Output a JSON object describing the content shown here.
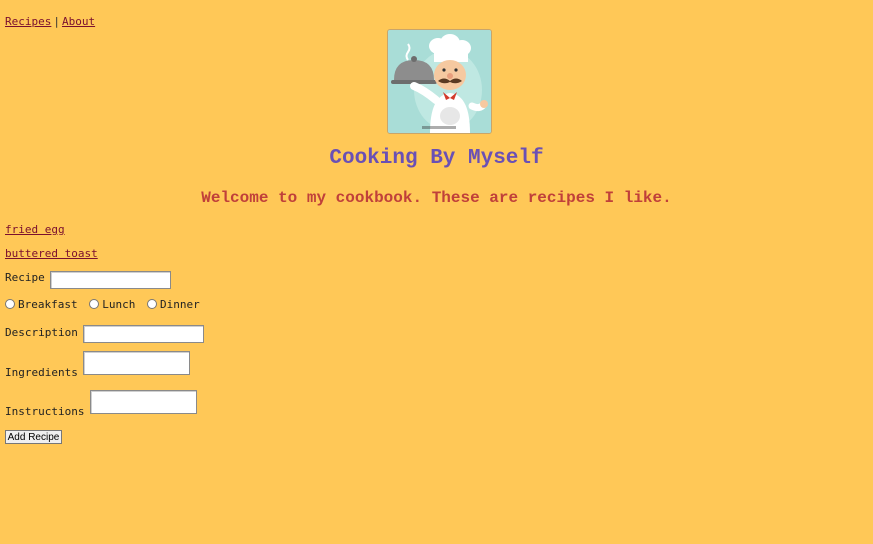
{
  "nav": {
    "recipes": "Recipes",
    "separator": "|",
    "about": "About"
  },
  "header": {
    "title": "Cooking By Myself",
    "subtitle": "Welcome to my cookbook. These are recipes I like."
  },
  "recipes": [
    "fried egg",
    "buttered toast"
  ],
  "form": {
    "recipe_label": "Recipe",
    "recipe_value": "",
    "meal_options": [
      "Breakfast",
      "Lunch",
      "Dinner"
    ],
    "description_label": "Description",
    "description_value": "",
    "ingredients_label": "Ingredients",
    "ingredients_value": "",
    "instructions_label": "Instructions",
    "instructions_value": "",
    "submit_label": "Add Recipe"
  },
  "logo": {
    "icon": "chef-logo-icon"
  },
  "colors": {
    "background": "#FFC857",
    "title": "#6A50B5",
    "subtitle": "#C0403A",
    "link": "#7A0F2E"
  }
}
